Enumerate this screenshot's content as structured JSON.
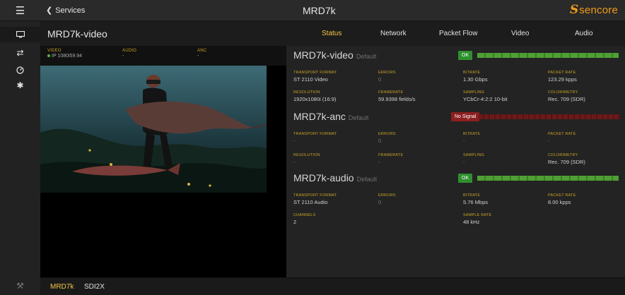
{
  "header": {
    "back_label": "Services",
    "app_title": "MRD7k",
    "brand": "sencore"
  },
  "input": {
    "name": "MRD7k-video",
    "signal": {
      "video_label": "VIDEO",
      "video_value": "IP 1080i59.94",
      "audio_label": "AUDIO",
      "audio_value": "-",
      "anc_label": "ANC",
      "anc_value": "-"
    }
  },
  "tabs": [
    {
      "label": "Status"
    },
    {
      "label": "Network"
    },
    {
      "label": "Packet Flow"
    },
    {
      "label": "Video"
    },
    {
      "label": "Audio"
    }
  ],
  "streams": [
    {
      "name": "MRD7k-video",
      "default_label": "Default",
      "status": "OK",
      "status_color": "#2f8f2f",
      "fields": [
        {
          "label": "TRANSPORT FORMAT",
          "value": "ST 2110 Video"
        },
        {
          "label": "ERRORS",
          "value": "0"
        },
        {
          "label": "BITRATE",
          "value": "1.30 Gbps"
        },
        {
          "label": "PACKET RATE",
          "value": "123.29 kpps"
        },
        {
          "label": "RESOLUTION",
          "value": "1920x1080i (16:9)"
        },
        {
          "label": "FRAMERATE",
          "value": "59.9398 fields/s"
        },
        {
          "label": "SAMPLING",
          "value": "YCbCr-4:2:2 10-bit"
        },
        {
          "label": "COLORIMETRY",
          "value": "Rec. 709 (SDR)"
        }
      ]
    },
    {
      "name": "MRD7k-anc",
      "default_label": "Default",
      "status": "No Signal",
      "status_color": "#8c1f1f",
      "fields": [
        {
          "label": "TRANSPORT FORMAT",
          "value": "-"
        },
        {
          "label": "ERRORS",
          "value": "0"
        },
        {
          "label": "BITRATE",
          "value": "-"
        },
        {
          "label": "PACKET RATE",
          "value": "-"
        },
        {
          "label": "RESOLUTION",
          "value": "-"
        },
        {
          "label": "FRAMERATE",
          "value": "-"
        },
        {
          "label": "SAMPLING",
          "value": "-"
        },
        {
          "label": "COLORIMETRY",
          "value": "Rec. 709 (SDR)"
        }
      ]
    },
    {
      "name": "MRD7k-audio",
      "default_label": "Default",
      "status": "OK",
      "status_color": "#2f8f2f",
      "fields": [
        {
          "label": "TRANSPORT FORMAT",
          "value": "ST 2110 Audio"
        },
        {
          "label": "ERRORS",
          "value": "0"
        },
        {
          "label": "BITRATE",
          "value": "5.76 Mbps"
        },
        {
          "label": "PACKET RATE",
          "value": "8.00 kpps"
        },
        {
          "label": "CHANNELS",
          "value": "2"
        },
        {
          "label": "SAMPLE RATE",
          "value": "48 kHz"
        }
      ]
    }
  ],
  "bottom_tabs": [
    {
      "label": "MRD7k"
    },
    {
      "label": "SDI2X"
    }
  ],
  "colors": {
    "accent": "#f3c545",
    "brand": "#f29d1a",
    "label": "#c9a227",
    "ok": "#2f8f2f",
    "error": "#8c1f1f"
  },
  "icons": {
    "menu": "hamburger-icon",
    "monitor": "monitor-icon",
    "routing": "shuffle-icon",
    "status": "gauge-icon",
    "settings": "gear-icon",
    "tools": "wrench-icon"
  }
}
